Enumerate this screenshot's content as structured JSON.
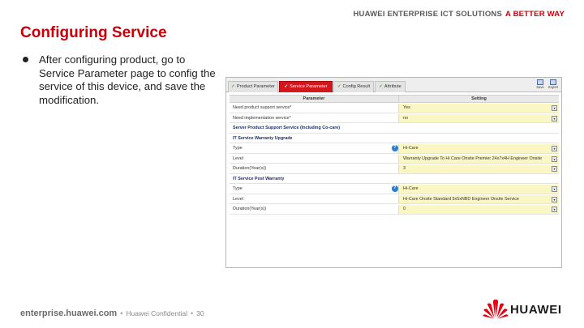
{
  "header": {
    "slogan_grey": "HUAWEI ENTERPRISE ICT SOLUTIONS",
    "slogan_red": "A BETTER WAY"
  },
  "slide": {
    "title": "Configuring Service",
    "bullet": "After configuring product, go to Service Parameter page to config the service of this device, and save the modification."
  },
  "app": {
    "tabs": [
      {
        "label": "Product Parameter"
      },
      {
        "label": "Service Parameter"
      },
      {
        "label": "Config Result"
      },
      {
        "label": "Attribute"
      }
    ],
    "toolbar": {
      "save_label": "Save",
      "export_label": "Export"
    },
    "columns": {
      "parameter": "Parameter",
      "setting": "Setting"
    },
    "rows": [
      {
        "param": "Need product support service*",
        "value": "Yes"
      },
      {
        "param": "Need implementation service*",
        "value": "no"
      },
      {
        "param": "Server Product Support Service (Including Co-care)"
      },
      {
        "param": "IT Service Warranty Upgrade"
      },
      {
        "param": "Type",
        "value": "Hi-Care"
      },
      {
        "param": "Level",
        "value": "Warranty Upgrade To Hi Care Onsite Premier 24x7x4H Engineer Onsite"
      },
      {
        "param": "Duration(Year(s))",
        "value": "3"
      },
      {
        "param": "IT Service Post Warranty"
      },
      {
        "param": "Type",
        "value": "Hi-Care"
      },
      {
        "param": "Level",
        "value": "Hi-Care Onsite Standard 9x5xNBD Engineer Onsite Service"
      },
      {
        "param": "Duration(Year(s))",
        "value": "0"
      }
    ]
  },
  "footer": {
    "site": "enterprise.huawei.com",
    "sep": "•",
    "confidential": "Huawei Confidential",
    "page": "30",
    "logo_text": "HUAWEI"
  },
  "colors": {
    "brand_red": "#c7000b",
    "tab_active": "#d4161d",
    "setting_bg": "#fbf7c4",
    "help_blue": "#2f7ec8"
  }
}
